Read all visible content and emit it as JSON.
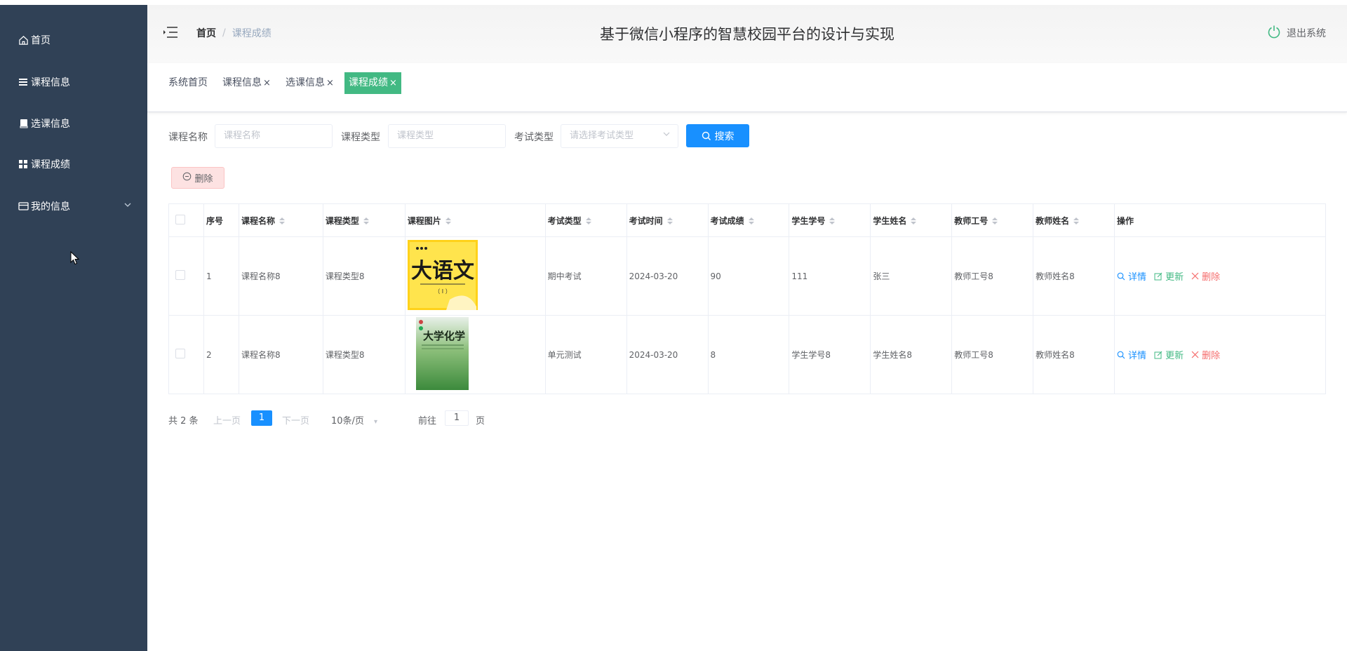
{
  "sidebar": {
    "items": [
      {
        "label": "首页",
        "icon": "home-icon"
      },
      {
        "label": "课程信息",
        "icon": "list-icon"
      },
      {
        "label": "选课信息",
        "icon": "book-icon"
      },
      {
        "label": "课程成绩",
        "icon": "grid-icon"
      },
      {
        "label": "我的信息",
        "icon": "card-icon"
      }
    ]
  },
  "header": {
    "breadcrumb_home": "首页",
    "breadcrumb_separator": "/",
    "breadcrumb_current": "课程成绩",
    "title": "基于微信小程序的智慧校园平台的设计与实现",
    "logout": "退出系统"
  },
  "tags": [
    {
      "label": "系统首页",
      "closable": false
    },
    {
      "label": "课程信息",
      "closable": true
    },
    {
      "label": "选课信息",
      "closable": true
    },
    {
      "label": "课程成绩",
      "closable": true,
      "active": true
    }
  ],
  "tag_close": "×",
  "search": {
    "course_name_label": "课程名称",
    "course_name_placeholder": "课程名称",
    "course_type_label": "课程类型",
    "course_type_placeholder": "课程类型",
    "exam_type_label": "考试类型",
    "exam_type_placeholder": "请选择考试类型",
    "search_button": "搜索"
  },
  "toolbar": {
    "delete_button": "删除"
  },
  "table": {
    "headers": [
      "序号",
      "课程名称",
      "课程类型",
      "课程图片",
      "考试类型",
      "考试时间",
      "考试成绩",
      "学生学号",
      "学生姓名",
      "教师工号",
      "教师姓名",
      "操作"
    ],
    "rows": [
      {
        "index": "1",
        "course_name": "课程名称8",
        "course_type": "课程类型8",
        "image": "大语文 book cover",
        "exam_type": "期中考试",
        "exam_time": "2024-03-20",
        "score": "90",
        "student_no": "111",
        "student_name": "张三",
        "teacher_no": "教师工号8",
        "teacher_name": "教师姓名8"
      },
      {
        "index": "2",
        "course_name": "课程名称8",
        "course_type": "课程类型8",
        "image": "大学化学 book cover",
        "exam_type": "单元测试",
        "exam_time": "2024-03-20",
        "score": "8",
        "student_no": "学生学号8",
        "student_name": "学生姓名8",
        "teacher_no": "教师工号8",
        "teacher_name": "教师姓名8"
      }
    ],
    "ops": {
      "detail": "详情",
      "update": "更新",
      "delete": "删除"
    },
    "cover1_title": "大语文",
    "cover1_sub": "（ I ）",
    "cover2_title": "大学化学"
  },
  "pagination": {
    "total": "共 2 条",
    "prev": "上一页",
    "current": "1",
    "next": "下一页",
    "page_size": "10条/页",
    "goto": "前往",
    "goto_value": "1",
    "page_unit": "页"
  },
  "colors": {
    "sidebar_bg": "#304156",
    "primary": "#1890ff",
    "active_tag": "#42b983",
    "danger": "#f56c6c"
  }
}
